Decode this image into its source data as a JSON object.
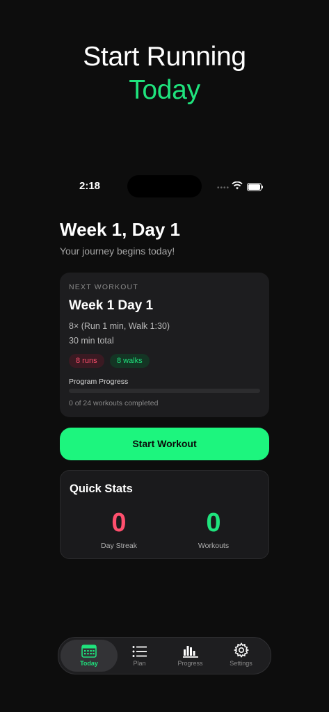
{
  "hero": {
    "line1": "Start Running",
    "line2": "Today"
  },
  "status_bar": {
    "time": "2:18",
    "dots": "••••"
  },
  "header": {
    "title": "Week 1, Day 1",
    "subtitle": "Your journey begins today!"
  },
  "next_workout": {
    "label": "NEXT WORKOUT",
    "title": "Week 1 Day 1",
    "description": "8× (Run 1 min, Walk 1:30)",
    "total": "30 min total",
    "runs_badge": "8 runs",
    "walks_badge": "8 walks",
    "progress_label": "Program Progress",
    "progress_fraction": 0,
    "progress_text": "0 of 24 workouts completed"
  },
  "start_button": {
    "label": "Start Workout"
  },
  "quick_stats": {
    "title": "Quick Stats",
    "items": [
      {
        "value": "0",
        "label": "Day Streak"
      },
      {
        "value": "0",
        "label": "Workouts"
      }
    ]
  },
  "tabs": [
    {
      "label": "Today",
      "icon": "calendar-icon",
      "active": true
    },
    {
      "label": "Plan",
      "icon": "list-icon",
      "active": false
    },
    {
      "label": "Progress",
      "icon": "bar-chart-icon",
      "active": false
    },
    {
      "label": "Settings",
      "icon": "gear-icon",
      "active": false
    }
  ],
  "colors": {
    "accent": "#1df57e",
    "runs": "#ff4f6d",
    "background": "#0d0d0d",
    "card": "#1d1d1f"
  }
}
